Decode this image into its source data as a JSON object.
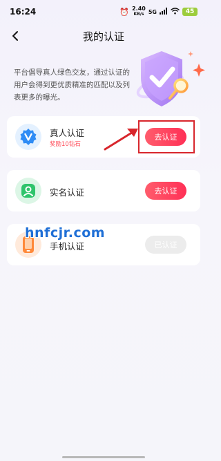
{
  "status_bar": {
    "time": "16:24",
    "speed_value": "2.40",
    "speed_unit": "KB/s",
    "network": "5G",
    "battery": "45"
  },
  "header": {
    "title": "我的认证"
  },
  "intro": {
    "text": "平台倡导真人绿色交友，通过认证的用户会得到更优质精准的匹配以及列表更多的曝光。"
  },
  "cards": [
    {
      "title": "真人认证",
      "subtitle": "奖励10钻石",
      "button": "去认证",
      "icon": "verified-badge-icon",
      "state": "active"
    },
    {
      "title": "实名认证",
      "button": "去认证",
      "icon": "person-id-icon",
      "state": "active"
    },
    {
      "title": "手机认证",
      "button": "已认证",
      "icon": "phone-icon",
      "state": "done"
    }
  ],
  "watermark": {
    "text": "hnfcjr.com"
  },
  "colors": {
    "accent": "#ff3f5e",
    "highlight": "#d8262c",
    "background": "#f5f4fb"
  }
}
